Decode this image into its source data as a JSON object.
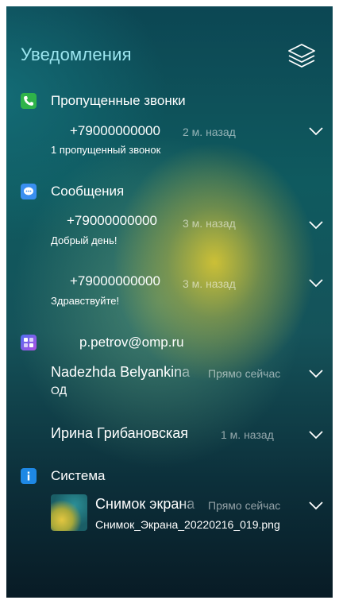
{
  "header": {
    "title": "Уведомления",
    "layers_icon": "layers-icon"
  },
  "colors": {
    "accent": "#9ce6f0",
    "phone": "#2fb34a",
    "messages": "#3a8ff0",
    "mail": "#6d5de8",
    "system": "#1e88e5"
  },
  "groups": [
    {
      "label": "Пропущенные звонки",
      "icon": "phone-icon",
      "items": [
        {
          "title": "+79000000000",
          "time": "2 м. назад",
          "body": "1 пропущенный звонок"
        }
      ]
    },
    {
      "label": "Сообщения",
      "icon": "message-icon",
      "items": [
        {
          "title": "+79000000000",
          "time": "3 м. назад",
          "body": "Добрый день!"
        },
        {
          "title": "+79000000000",
          "time": "3 м. назад",
          "body": "Здравствуйте!"
        }
      ]
    },
    {
      "label": "p.petrov@omp.ru",
      "icon": "mail-app-icon",
      "items": [
        {
          "title": "Nadezhda Belyankina",
          "time": "Прямо сейчас",
          "body": "ОД"
        },
        {
          "title": "Ирина Грибановская",
          "time": "1 м. назад",
          "body": ""
        }
      ]
    },
    {
      "label": "Система",
      "icon": "info-icon",
      "items": [
        {
          "title": "Снимок экрана",
          "time": "Прямо сейчас",
          "body": "Снимок_Экрана_20220216_019.png"
        }
      ]
    }
  ]
}
